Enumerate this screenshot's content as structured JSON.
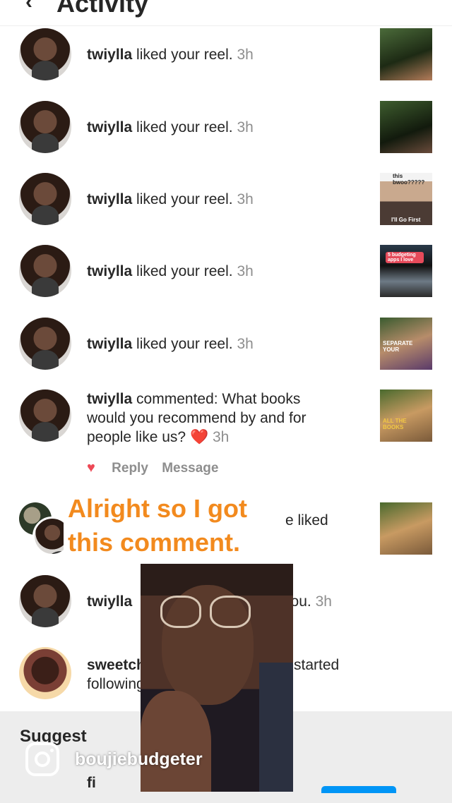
{
  "header": {
    "title": "Activity"
  },
  "notifications": [
    {
      "user": "twiylla",
      "action": "liked your reel.",
      "time": "3h"
    },
    {
      "user": "twiylla",
      "action": "liked your reel.",
      "time": "3h"
    },
    {
      "user": "twiylla",
      "action": "liked your reel.",
      "time": "3h",
      "thumb_top": "this bwoo?????",
      "thumb_bottom": "I'll Go First"
    },
    {
      "user": "twiylla",
      "action": "liked your reel.",
      "time": "3h",
      "thumb_tag": "5 budgeting apps I love"
    },
    {
      "user": "twiylla",
      "action": "liked your reel.",
      "time": "3h",
      "thumb_text": "SEPARATE YOUR"
    }
  ],
  "comment": {
    "user": "twiylla",
    "line1": "commented: What books",
    "line2": "would you recommend by and for",
    "line3": "people like us?",
    "emoji": "❤️",
    "time": "3h",
    "reply_label": "Reply",
    "message_label": "Message",
    "thumb_text": "ALL THE BOOKS"
  },
  "partial_rows": {
    "liked_tail": "e liked",
    "following_user": "twiylla",
    "following_tail": "wing you.",
    "following_time": "3h",
    "sweet_user": "sweetch",
    "sweet_tail": "started",
    "sweet_line2": "following"
  },
  "overlay": {
    "line1": "Alright so I got",
    "line2": "this comment."
  },
  "suggested": {
    "label": "Suggest",
    "name_fragment": "fi"
  },
  "watermark": {
    "handle": "boujiebudgeter"
  },
  "colors": {
    "accent": "#f28a1e",
    "heart": "#ed4956",
    "follow_blue": "#0095f6"
  }
}
